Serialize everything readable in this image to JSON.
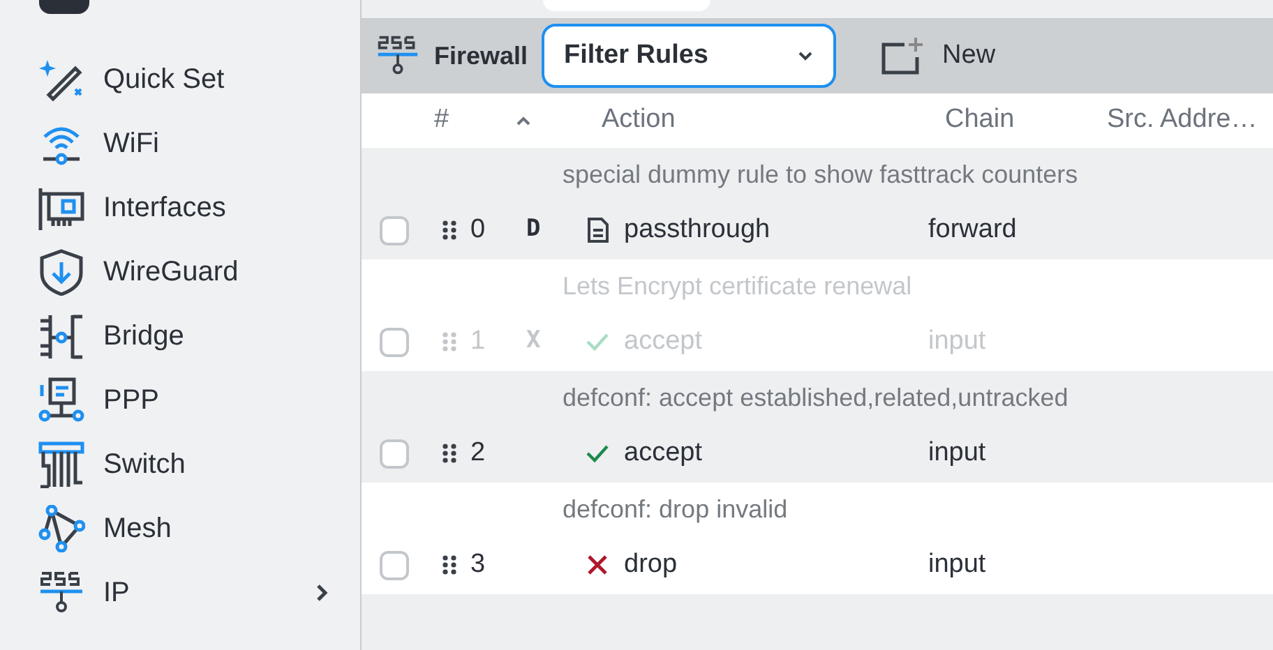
{
  "sidebar": {
    "items": [
      {
        "label": "Quick Set",
        "has_submenu": false
      },
      {
        "label": "WiFi",
        "has_submenu": false
      },
      {
        "label": "Interfaces",
        "has_submenu": false
      },
      {
        "label": "WireGuard",
        "has_submenu": false
      },
      {
        "label": "Bridge",
        "has_submenu": false
      },
      {
        "label": "PPP",
        "has_submenu": false
      },
      {
        "label": "Switch",
        "has_submenu": false
      },
      {
        "label": "Mesh",
        "has_submenu": false
      },
      {
        "label": "IP",
        "has_submenu": true
      }
    ]
  },
  "toolbar": {
    "title": "Firewall",
    "menu": {
      "value": "Filter Rules"
    },
    "new_button": "New"
  },
  "table": {
    "columns": [
      "#",
      "Action",
      "Chain",
      "Src. Addre…"
    ],
    "rows": [
      {
        "comment": "special dummy rule to show fasttrack counters",
        "number": "0",
        "flag": "D",
        "action": "passthrough",
        "kind": "passthrough",
        "chain": "forward",
        "disabled": false,
        "checked": false
      },
      {
        "comment": "Lets Encrypt certificate renewal",
        "number": "1",
        "flag": "X",
        "action": "accept",
        "kind": "accept",
        "chain": "input",
        "disabled": true,
        "checked": false
      },
      {
        "comment": "defconf: accept established,related,untracked",
        "number": "2",
        "action": "accept",
        "kind": "accept",
        "chain": "input",
        "disabled": false,
        "checked": false
      },
      {
        "comment": "defconf: drop invalid",
        "number": "3",
        "action": "drop",
        "kind": "drop",
        "chain": "input",
        "disabled": false,
        "checked": false
      }
    ]
  }
}
